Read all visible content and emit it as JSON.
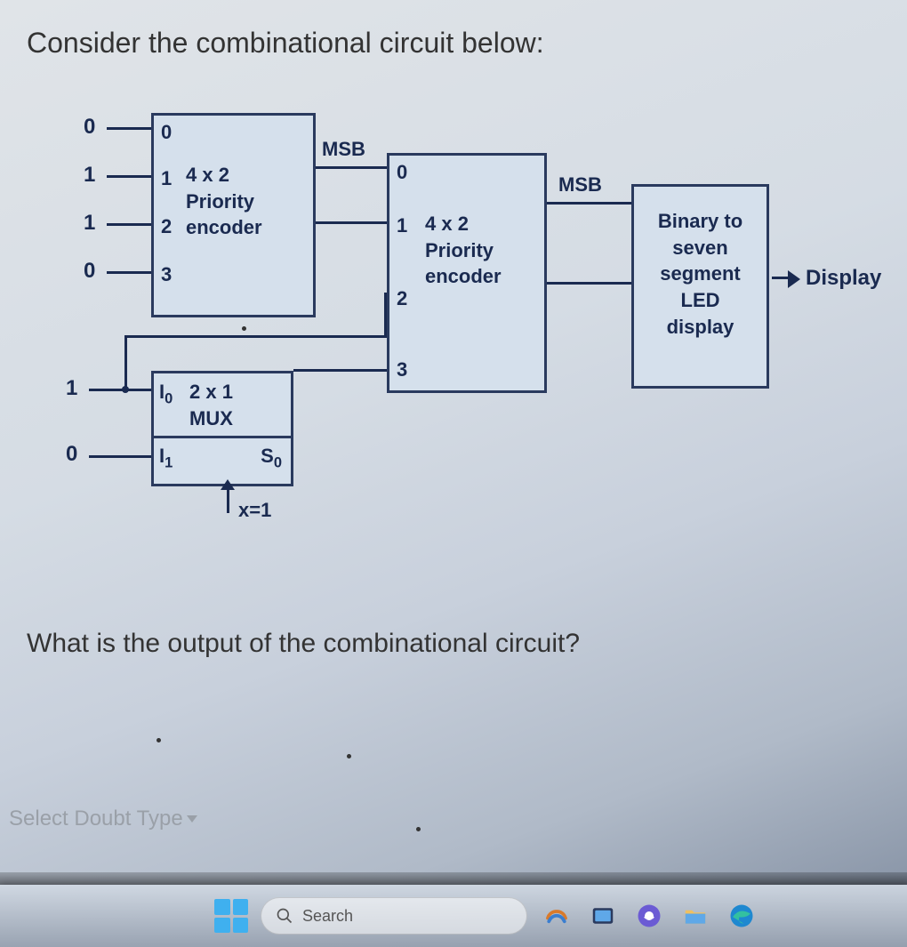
{
  "question": {
    "title": "Consider the combinational circuit below:",
    "prompt": "What is the output of the combinational circuit?"
  },
  "diagram": {
    "encoder1": {
      "name": "4 x 2\nPriority\nencoder",
      "ports": [
        "0",
        "1",
        "2",
        "3"
      ],
      "inputs": [
        "0",
        "1",
        "1",
        "0"
      ],
      "msb_label": "MSB"
    },
    "encoder2": {
      "name": "4 x 2\nPriority\nencoder",
      "ports": [
        "0",
        "1",
        "2",
        "3"
      ],
      "msb_label": "MSB"
    },
    "mux": {
      "name": "2 x 1\nMUX",
      "i0_label": "I₀",
      "i1_label": "I₁",
      "s0_label": "S₀",
      "inputs": {
        "i0": "1",
        "i1": "0"
      },
      "select_value": "x=1"
    },
    "seven_seg": {
      "name": "Binary to\nseven\nsegment\nLED\ndisplay",
      "output_label": "Display"
    }
  },
  "ui": {
    "doubt_selector": "Select Doubt Type",
    "search_placeholder": "Search"
  },
  "taskbar": {
    "items": [
      "start",
      "search",
      "copilot",
      "gallery",
      "chat",
      "file-explorer",
      "edge"
    ]
  }
}
